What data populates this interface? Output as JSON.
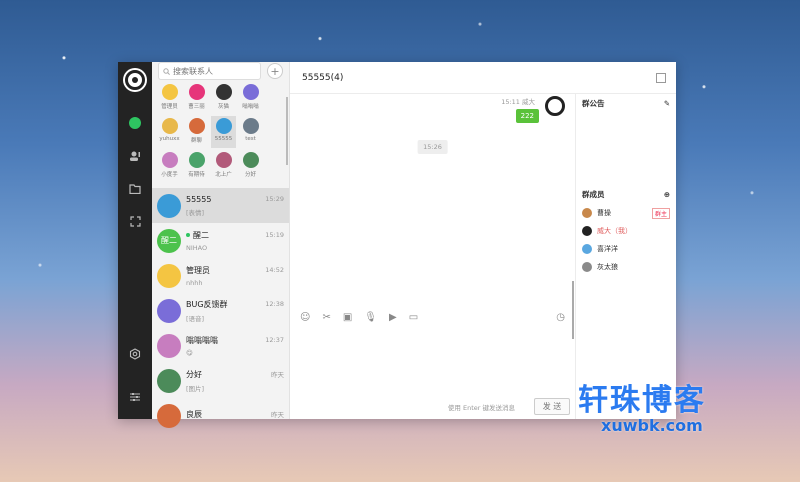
{
  "colors": {
    "accent": "#2ec561",
    "bubble": "#5ac23a",
    "nav_bg": "#232323",
    "brand": "#2b7bf0"
  },
  "search": {
    "placeholder": "搜索联系人"
  },
  "nav_icons": [
    "chat-icon",
    "contacts-icon",
    "folder-icon",
    "fullscreen-icon",
    "settings-icon",
    "sliders-icon"
  ],
  "contacts_grid": [
    {
      "label": "管理员",
      "color": "#f4c542"
    },
    {
      "label": "曹三丽",
      "color": "#e6357a"
    },
    {
      "label": "灰猫",
      "color": "#333"
    },
    {
      "label": "嗡嗡嗡",
      "color": "#7a6dd8"
    },
    {
      "label": "yuhuxx",
      "color": "#e8b84a"
    },
    {
      "label": "群聊",
      "color": "#d66a3b"
    },
    {
      "label": "55555",
      "color": "#3a9bd7",
      "selected": true
    },
    {
      "label": "test",
      "color": "#6b7b8a"
    },
    {
      "label": "小度手",
      "color": "#c77dbf"
    },
    {
      "label": "有期待",
      "color": "#4aa36a"
    },
    {
      "label": "北上广",
      "color": "#b25a7a"
    },
    {
      "label": "分好",
      "color": "#4c8b5a"
    }
  ],
  "conversations": [
    {
      "name": "55555",
      "time": "15:29",
      "preview": "[表情]",
      "color": "#3a9bd7",
      "selected": true
    },
    {
      "name": "醒二",
      "time": "15:19",
      "preview": "NIHAO",
      "color": "#4cc24c",
      "online": true,
      "avatar_text": "醒二"
    },
    {
      "name": "管理员",
      "time": "14:52",
      "preview": "nhhh",
      "color": "#f4c542"
    },
    {
      "name": "BUG反馈群",
      "time": "12:38",
      "preview": "[语音]",
      "color": "#7a6dd8"
    },
    {
      "name": "嗡嗡嗡嗡",
      "time": "12:37",
      "preview": "😋",
      "color": "#c77dbf"
    },
    {
      "name": "分好",
      "time": "昨天",
      "preview": "[图片]",
      "color": "#4c8b5a"
    },
    {
      "name": "良辰",
      "time": "昨天",
      "preview": "",
      "color": "#d66a3b"
    }
  ],
  "chat": {
    "title": "55555(4)",
    "meta_time": "15:11",
    "meta_name": "威大",
    "bubble": "222",
    "timestamp": "15:26",
    "hint": "使用 Enter 键发送消息",
    "send_label": "发 送"
  },
  "sidebar": {
    "notice_title": "群公告",
    "members_title": "群成员",
    "members": [
      {
        "name": "曹操",
        "color": "#c8884b",
        "badge": "群主"
      },
      {
        "name": "威大（我）",
        "color": "#222",
        "me": true
      },
      {
        "name": "喜洋洋",
        "color": "#5aa7e0"
      },
      {
        "name": "灰太狼",
        "color": "#8a8a8a"
      }
    ]
  },
  "watermark": {
    "title": "轩珠博客",
    "url": "xuwbk.com"
  }
}
